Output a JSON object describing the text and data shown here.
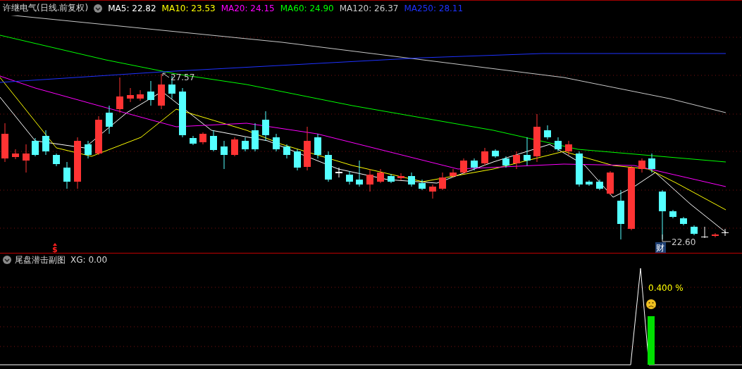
{
  "header": {
    "title": "许继电气(日线.前复权)",
    "moving_averages": [
      {
        "label": "MA5: 22.82",
        "color": "#ffffff"
      },
      {
        "label": "MA10: 23.53",
        "color": "#ffff00"
      },
      {
        "label": "MA20: 24.15",
        "color": "#ff00ff"
      },
      {
        "label": "MA60: 24.90",
        "color": "#00ff00"
      },
      {
        "label": "MA120: 26.37",
        "color": "#c8c8c8"
      },
      {
        "label": "MA250: 28.11",
        "color": "#1e32ff"
      }
    ]
  },
  "price_chart": {
    "high_marker": "27.57",
    "low_marker": "22.60",
    "news_badge": "财",
    "signal_marker": "$"
  },
  "indicator": {
    "title": "尾盘潜击副图",
    "reading": "XG: 0.00",
    "percent_label": "0.400 %"
  }
}
